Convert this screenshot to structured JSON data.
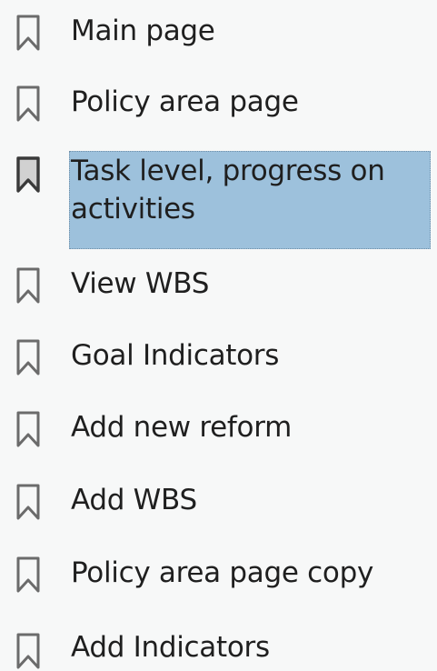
{
  "bookmarks": {
    "items": [
      {
        "label": "Main page"
      },
      {
        "label": "Policy area page"
      },
      {
        "label": "Task level, progress on activities"
      },
      {
        "label": "View WBS"
      },
      {
        "label": "Goal Indicators"
      },
      {
        "label": "Add new reform"
      },
      {
        "label": "Add WBS"
      },
      {
        "label": "Policy area page copy"
      },
      {
        "label": "Add Indicators"
      }
    ],
    "selected_index": 2,
    "icon": "bookmark-icon"
  },
  "colors": {
    "selection_bg": "#9dc1dc",
    "icon_stroke": "#6b6b6b",
    "icon_fill_selected": "#8a8a8a",
    "background": "#f7f8f8"
  }
}
